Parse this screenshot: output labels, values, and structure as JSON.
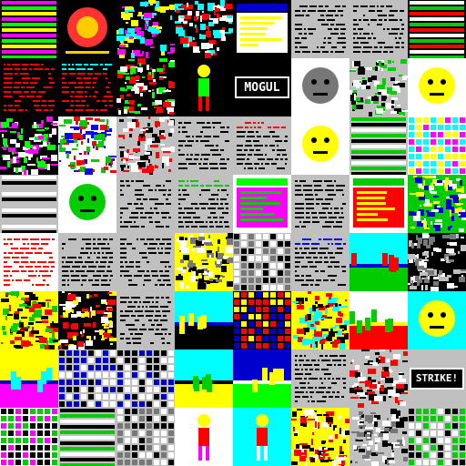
{
  "gallery": {
    "columns": 8,
    "rows": 8,
    "tiles": [
      {
        "style": "bars",
        "bg": "#000000",
        "c1": "#ff00ff",
        "c2": "#00ff00",
        "c3": "#ffff00"
      },
      {
        "style": "blob",
        "bg": "#000000",
        "c1": "#ff3333",
        "c2": "#ffcc00"
      },
      {
        "style": "noise",
        "bg": "#000000",
        "c1": "#ff00ff",
        "c2": "#ffff00",
        "c3": "#00ffff"
      },
      {
        "style": "noise",
        "bg": "#000000",
        "c1": "#00ffff",
        "c2": "#ff0000",
        "c3": "#ffffff"
      },
      {
        "style": "window",
        "bg": "#000000",
        "c1": "#0000cc",
        "c2": "#ffff00",
        "c3": "#ffffff"
      },
      {
        "style": "text",
        "bg": "#c0c0c0",
        "c1": "#000000",
        "c2": "#000000"
      },
      {
        "style": "text",
        "bg": "#c0c0c0",
        "c1": "#000000",
        "c2": "#000000"
      },
      {
        "style": "bars",
        "bg": "#000000",
        "c1": "#ffffff",
        "c2": "#00cc00",
        "c3": "#ff0000"
      },
      {
        "style": "text",
        "bg": "#000000",
        "c1": "#ff0000",
        "c2": "#ff0000"
      },
      {
        "style": "text",
        "bg": "#000000",
        "c1": "#ff0000",
        "c2": "#00ffff"
      },
      {
        "style": "noise",
        "bg": "#000000",
        "c1": "#00ff00",
        "c2": "#ff0000",
        "c3": "#ffffff"
      },
      {
        "style": "figure",
        "bg": "#000000",
        "c1": "#00ff00",
        "c2": "#ffff00",
        "c3": "#ff0000"
      },
      {
        "style": "banner",
        "bg": "#000000",
        "c1": "#ffffff",
        "c2": "#000000",
        "label": "MOGUL"
      },
      {
        "style": "face",
        "bg": "#ffffff",
        "c1": "#000000",
        "c2": "#777777"
      },
      {
        "style": "noise",
        "bg": "#c0c0c0",
        "c1": "#000000",
        "c2": "#ffffff",
        "c3": "#00cc00"
      },
      {
        "style": "face",
        "bg": "#ffffff",
        "c1": "#000000",
        "c2": "#ffff00"
      },
      {
        "style": "noise",
        "bg": "#000000",
        "c1": "#ffffff",
        "c2": "#00ff00",
        "c3": "#ff00ff"
      },
      {
        "style": "noise",
        "bg": "#ffffff",
        "c1": "#ff0000",
        "c2": "#0000ff",
        "c3": "#00cc00"
      },
      {
        "style": "noise",
        "bg": "#c0c0c0",
        "c1": "#000000",
        "c2": "#ff0000",
        "c3": "#ffffff"
      },
      {
        "style": "text",
        "bg": "#c0c0c0",
        "c1": "#000000",
        "c2": "#000000"
      },
      {
        "style": "text",
        "bg": "#c0c0c0",
        "c1": "#000000",
        "c2": "#ff0000"
      },
      {
        "style": "face",
        "bg": "#ffffff",
        "c1": "#000000",
        "c2": "#ffff00"
      },
      {
        "style": "bars",
        "bg": "#c0c0c0",
        "c1": "#00cc00",
        "c2": "#000000",
        "c3": "#ffffff"
      },
      {
        "style": "grid",
        "bg": "#ffffff",
        "c1": "#ff00ff",
        "c2": "#00ffff",
        "c3": "#ffff00"
      },
      {
        "style": "bars",
        "bg": "#c0c0c0",
        "c1": "#ffffff",
        "c2": "#000000",
        "c3": "#c0c0c0"
      },
      {
        "style": "face",
        "bg": "#ffffff",
        "c1": "#000000",
        "c2": "#00cc00"
      },
      {
        "style": "text",
        "bg": "#c0c0c0",
        "c1": "#000000",
        "c2": "#000000"
      },
      {
        "style": "text",
        "bg": "#c0c0c0",
        "c1": "#000000",
        "c2": "#00cc00"
      },
      {
        "style": "window",
        "bg": "#ffffff",
        "c1": "#00ff00",
        "c2": "#00cc00",
        "c3": "#ff00ff"
      },
      {
        "style": "text",
        "bg": "#c0c0c0",
        "c1": "#000000",
        "c2": "#000000"
      },
      {
        "style": "window",
        "bg": "#ffffff",
        "c1": "#00cc00",
        "c2": "#ffff00",
        "c3": "#ff0000"
      },
      {
        "style": "noise",
        "bg": "#00cc00",
        "c1": "#0000cc",
        "c2": "#ffff00",
        "c3": "#ffffff"
      },
      {
        "style": "text",
        "bg": "#ffffff",
        "c1": "#ff0000",
        "c2": "#ff0000"
      },
      {
        "style": "text",
        "bg": "#c0c0c0",
        "c1": "#000000",
        "c2": "#000000"
      },
      {
        "style": "text",
        "bg": "#c0c0c0",
        "c1": "#000000",
        "c2": "#000000"
      },
      {
        "style": "noise",
        "bg": "#ffff00",
        "c1": "#000000",
        "c2": "#777777",
        "c3": "#ffffff"
      },
      {
        "style": "grid",
        "bg": "#c0c0c0",
        "c1": "#000000",
        "c2": "#ffffff",
        "c3": "#777777"
      },
      {
        "style": "text",
        "bg": "#c0c0c0",
        "c1": "#000000",
        "c2": "#0000ff"
      },
      {
        "style": "landscape",
        "bg": "#00ffff",
        "c1": "#00cc00",
        "c2": "#ff0000",
        "c3": "#0000cc"
      },
      {
        "style": "noise",
        "bg": "#000000",
        "c1": "#ffffff",
        "c2": "#777777",
        "c3": "#c0c0c0"
      },
      {
        "style": "noise",
        "bg": "#ffff00",
        "c1": "#000000",
        "c2": "#ff0000",
        "c3": "#00cc00"
      },
      {
        "style": "noise",
        "bg": "#000000",
        "c1": "#ff0000",
        "c2": "#ffffff",
        "c3": "#ffff00"
      },
      {
        "style": "text",
        "bg": "#c0c0c0",
        "c1": "#000000",
        "c2": "#000000"
      },
      {
        "style": "landscape",
        "bg": "#00ffff",
        "c1": "#000000",
        "c2": "#ffff00",
        "c3": "#0000cc"
      },
      {
        "style": "grid",
        "bg": "#000000",
        "c1": "#0000cc",
        "c2": "#ffff00",
        "c3": "#ff0000"
      },
      {
        "style": "noise",
        "bg": "#ffff00",
        "c1": "#ff0000",
        "c2": "#000000",
        "c3": "#00ffff"
      },
      {
        "style": "landscape",
        "bg": "#ffffff",
        "c1": "#ff0000",
        "c2": "#00cc00",
        "c3": "#ffff00"
      },
      {
        "style": "face",
        "bg": "#00ffff",
        "c1": "#000000",
        "c2": "#ffff00"
      },
      {
        "style": "landscape",
        "bg": "#ffff00",
        "c1": "#ff00ff",
        "c2": "#00ffff",
        "c3": "#0000cc"
      },
      {
        "style": "grid",
        "bg": "#c0c0c0",
        "c1": "#000000",
        "c2": "#0000cc",
        "c3": "#ffffff"
      },
      {
        "style": "grid",
        "bg": "#c0c0c0",
        "c1": "#000000",
        "c2": "#0000cc",
        "c3": "#ffffff"
      },
      {
        "style": "landscape",
        "bg": "#00ffff",
        "c1": "#ffff00",
        "c2": "#00cc00",
        "c3": "#000000"
      },
      {
        "style": "landscape",
        "bg": "#0000cc",
        "c1": "#00ff00",
        "c2": "#ffff00",
        "c3": "#ffffff"
      },
      {
        "style": "text",
        "bg": "#c0c0c0",
        "c1": "#000000",
        "c2": "#000000"
      },
      {
        "style": "noise",
        "bg": "#c0c0c0",
        "c1": "#000000",
        "c2": "#ff0000",
        "c3": "#ffffff"
      },
      {
        "style": "banner",
        "bg": "#c0c0c0",
        "c1": "#ffffff",
        "c2": "#000000",
        "label": "STRIKE!"
      },
      {
        "style": "grid",
        "bg": "#ffffff",
        "c1": "#000000",
        "c2": "#ff00ff",
        "c3": "#00cc00"
      },
      {
        "style": "bars",
        "bg": "#c0c0c0",
        "c1": "#000000",
        "c2": "#00cc00",
        "c3": "#ffffff"
      },
      {
        "style": "grid",
        "bg": "#c0c0c0",
        "c1": "#000000",
        "c2": "#ffffff",
        "c3": "#777777"
      },
      {
        "style": "figure",
        "bg": "#ffffff",
        "c1": "#ff0000",
        "c2": "#ffff00",
        "c3": "#ff00ff"
      },
      {
        "style": "figure",
        "bg": "#00ffff",
        "c1": "#ff0000",
        "c2": "#ffff00",
        "c3": "#ffffff"
      },
      {
        "style": "noise",
        "bg": "#ffff00",
        "c1": "#ff0000",
        "c2": "#000000",
        "c3": "#ffffff"
      },
      {
        "style": "noise",
        "bg": "#c0c0c0",
        "c1": "#000000",
        "c2": "#ffffff",
        "c3": "#777777"
      },
      {
        "style": "grid",
        "bg": "#c0c0c0",
        "c1": "#000000",
        "c2": "#ffffff",
        "c3": "#00cc00"
      }
    ]
  }
}
